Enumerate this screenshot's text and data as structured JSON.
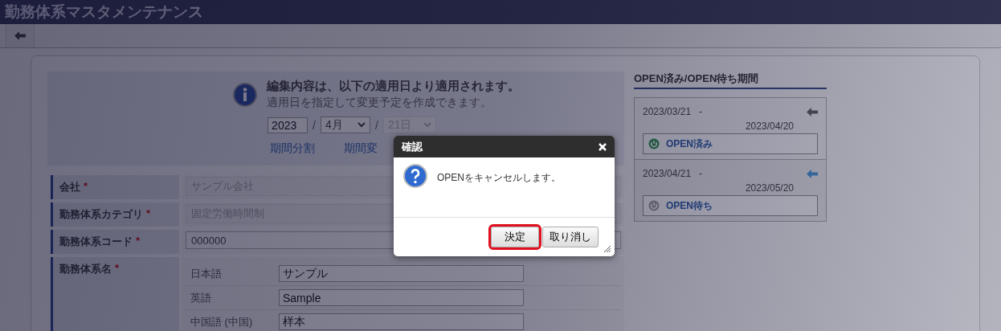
{
  "window": {
    "title": "勤務体系マスタメンテナンス"
  },
  "notice": {
    "title": "編集内容は、以下の適用日より適用されます。",
    "text": "適用日を指定して変更予定を作成できます。"
  },
  "date": {
    "year": "2023",
    "separators": [
      "/",
      "/"
    ],
    "month": "4月",
    "day": "21日",
    "day_disabled": true
  },
  "links": [
    "期間分割",
    "期間変"
  ],
  "form": {
    "rows": [
      {
        "label": "会社",
        "required_mark": "*",
        "kind": "readonly",
        "value": "サンプル会社"
      },
      {
        "label": "勤務体系カテゴリ",
        "required_mark": "*",
        "kind": "readonly",
        "value": "固定労働時間制"
      },
      {
        "label": "勤務体系コード",
        "required_mark": "*",
        "kind": "input",
        "value": "000000"
      },
      {
        "label": "勤務体系名",
        "required_mark": "*",
        "kind": "names",
        "entries": [
          {
            "language": "日本語",
            "value": "サンプル"
          },
          {
            "language": "英語",
            "value": "Sample"
          },
          {
            "language": "中国語 (中国)",
            "value": "样本"
          }
        ]
      }
    ]
  },
  "periods": {
    "title": "OPEN済み/OPEN待ち期間",
    "items": [
      {
        "start": "2023/03/21",
        "dash": "-",
        "end": "2023/04/20",
        "status_label": "OPEN済み",
        "on": true,
        "selected": false
      },
      {
        "start": "2023/04/21",
        "dash": "-",
        "end": "2023/05/20",
        "status_label": "OPEN待ち",
        "on": false,
        "selected": true
      }
    ]
  },
  "dialog": {
    "title": "確認",
    "message": "OPENをキャンセルします。",
    "buttons": [
      {
        "label": "決定",
        "highlighted": true
      },
      {
        "label": "取り消し",
        "highlighted": false
      }
    ]
  }
}
